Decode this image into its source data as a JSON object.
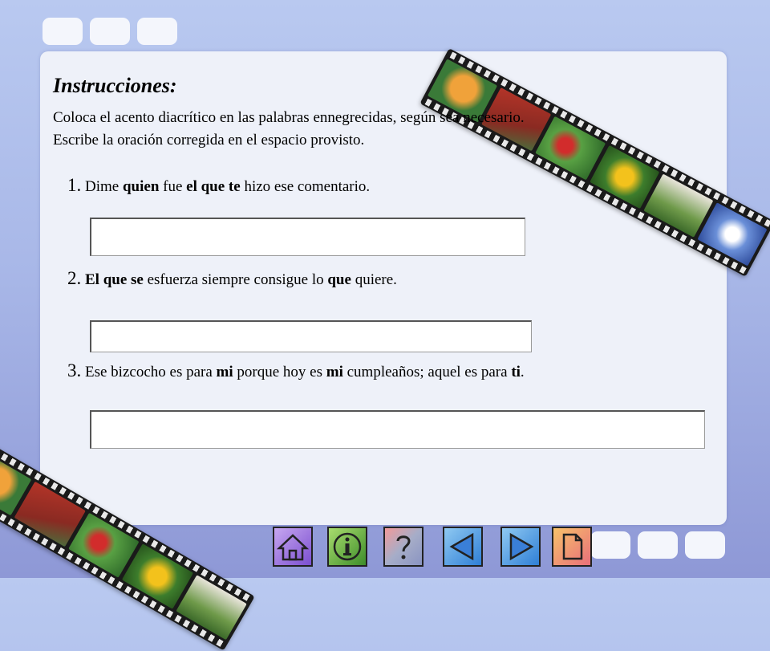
{
  "instructions": {
    "title": "Instrucciones:",
    "line1": "Coloca el acento diacrítico en las palabras ennegrecidas, según sea necesario.",
    "line2": "Escribe la oración corregida en el espacio provisto."
  },
  "questions": [
    {
      "number": "1.",
      "parts": [
        " Dime ",
        "quien",
        " fue ",
        "el que te",
        " hizo  ese comentario."
      ],
      "answer_value": ""
    },
    {
      "number": "2.",
      "parts": [
        " ",
        "El que",
        " ",
        "se",
        " esfuerza siempre consigue lo ",
        "que",
        " quiere."
      ],
      "answer_value": ""
    },
    {
      "number": "3.",
      "parts": [
        " Ese bizcocho es para ",
        "mi",
        " porque hoy es ",
        "mi",
        " cumpleaños; aquel es para ",
        "ti",
        "."
      ],
      "answer_value": ""
    }
  ],
  "navigation": {
    "icons": [
      "home-icon",
      "info-icon",
      "help-icon",
      "back-arrow-icon",
      "forward-arrow-icon",
      "page-icon"
    ]
  },
  "colors": {
    "background": "#a9b8e8",
    "panel": "#eef1f9",
    "tab": "#f4f6fc",
    "film": "#1a1a1a"
  }
}
